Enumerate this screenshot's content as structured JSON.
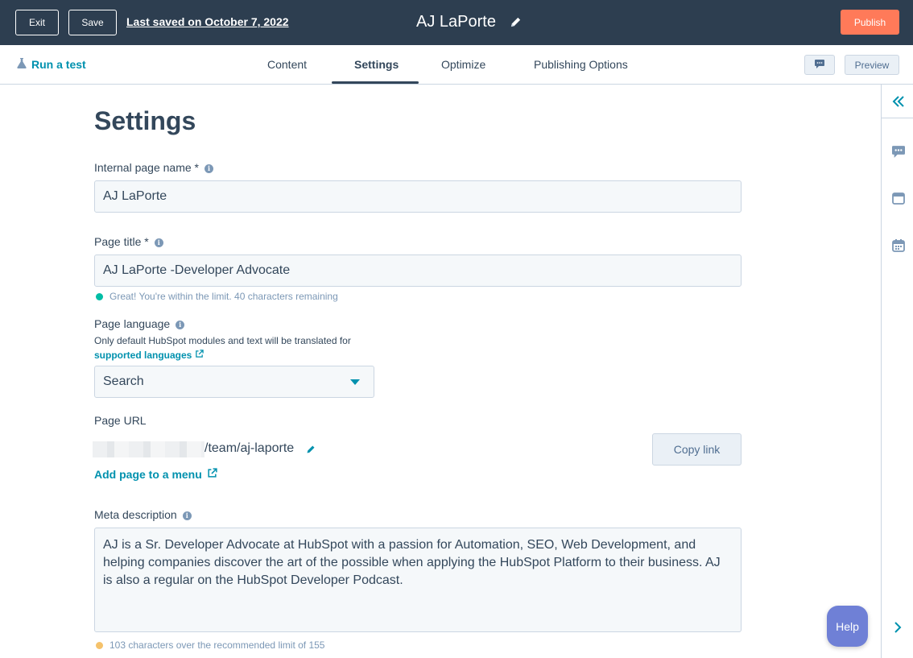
{
  "topbar": {
    "exit_label": "Exit",
    "save_label": "Save",
    "last_saved": "Last saved on October 7, 2022",
    "page_name": "AJ LaPorte",
    "publish_label": "Publish"
  },
  "tabbar": {
    "run_test": "Run a test",
    "tabs": [
      "Content",
      "Settings",
      "Optimize",
      "Publishing Options"
    ],
    "active_tab": "Settings",
    "preview_label": "Preview"
  },
  "settings": {
    "heading": "Settings",
    "internal_name": {
      "label": "Internal page name *",
      "value": "AJ LaPorte"
    },
    "page_title": {
      "label": "Page title *",
      "value": "AJ LaPorte -Developer Advocate",
      "hint": "Great! You're within the limit. 40 characters remaining"
    },
    "page_language": {
      "label": "Page language",
      "description": "Only default HubSpot modules and text will be translated for",
      "link": "supported languages",
      "select_value": "Search"
    },
    "page_url": {
      "label": "Page URL",
      "path": "/team/aj-laporte",
      "copy_label": "Copy link",
      "add_menu": "Add page to a menu"
    },
    "meta_description": {
      "label": "Meta description",
      "value": "AJ is a Sr. Developer Advocate at HubSpot with a passion for Automation, SEO, Web Development, and helping companies discover the art of the possible when applying the HubSpot Platform to their business. AJ is also a regular on the HubSpot Developer Podcast.",
      "hint": "103 characters over the recommended limit of 155"
    }
  },
  "help_label": "Help",
  "colors": {
    "topbar": "#2d3e50",
    "accent": "#0091ae",
    "publish": "#ff7a59",
    "success": "#00bda5",
    "warning": "#f5c26b",
    "help": "#6f80d6"
  },
  "icons": {
    "pencil": "pencil-icon",
    "flask": "flask-icon",
    "info": "info-icon",
    "external_link": "external-link-icon",
    "comment": "comment-icon",
    "collapse": "double-chevron-left-icon",
    "layout": "layout-icon",
    "calendar": "calendar-icon",
    "expand": "chevron-right-icon"
  }
}
